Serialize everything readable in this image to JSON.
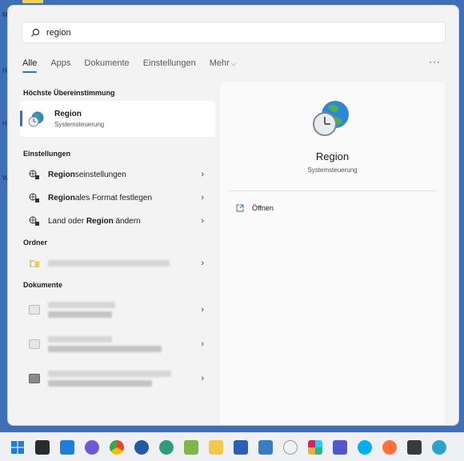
{
  "desktop": {
    "edge_letters": [
      "M",
      "H",
      "H",
      "W"
    ]
  },
  "search": {
    "query": "region"
  },
  "tabs": [
    "Alle",
    "Apps",
    "Dokumente",
    "Einstellungen",
    "Mehr"
  ],
  "best_match": {
    "section": "Höchste Übereinstimmung",
    "title": "Region",
    "subtitle": "Systemsteuerung"
  },
  "settings": {
    "section": "Einstellungen",
    "items": [
      {
        "bold": "Region",
        "rest": "seinstellungen"
      },
      {
        "bold": "Region",
        "rest": "ales Format festlegen"
      },
      {
        "prefix": "Land oder ",
        "bold": "Region",
        "rest": " ändern"
      }
    ]
  },
  "folders": {
    "section": "Ordner"
  },
  "documents": {
    "section": "Dokumente"
  },
  "detail": {
    "title": "Region",
    "subtitle": "Systemsteuerung",
    "action": "Öffnen"
  },
  "taskbar": {
    "icons": [
      "windows-start-icon",
      "taskview-icon",
      "widgets-icon",
      "teams-chat-icon",
      "chrome-icon",
      "github-icon",
      "edge-dev-icon",
      "notepad-icon",
      "explorer-icon",
      "word-icon",
      "calculator-icon",
      "wikipedia-icon",
      "slack-icon",
      "teams-icon",
      "skype-icon",
      "firefox-icon",
      "remote-icon",
      "edge-icon"
    ]
  },
  "colors": {
    "accent": "#2f6fd5",
    "panel": "#f3f3f3",
    "desktop": "#3f6fb6"
  }
}
